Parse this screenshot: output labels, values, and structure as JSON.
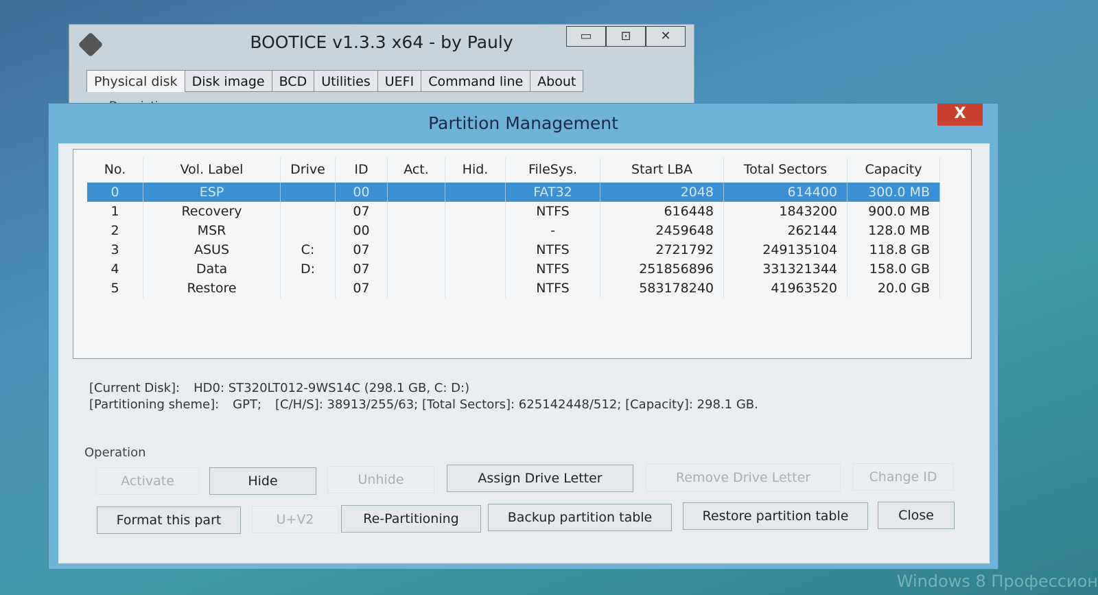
{
  "main_window": {
    "title": "BOOTICE v1.3.3 x64 - by Pauly",
    "controls": [
      "▭",
      "⊡",
      "✕"
    ],
    "tabs": [
      {
        "label": "Physical disk",
        "active": true
      },
      {
        "label": "Disk image"
      },
      {
        "label": "BCD"
      },
      {
        "label": "Utilities"
      },
      {
        "label": "UEFI"
      },
      {
        "label": "Command line"
      },
      {
        "label": "About"
      }
    ],
    "description_label": "Description"
  },
  "dialog": {
    "title": "Partition Management",
    "close": "X",
    "columns": [
      "No.",
      "Vol. Label",
      "Drive",
      "ID",
      "Act.",
      "Hid.",
      "FileSys.",
      "Start LBA",
      "Total Sectors",
      "Capacity"
    ],
    "rows": [
      [
        "0",
        "ESP",
        "",
        "00",
        "",
        "",
        "FAT32",
        "2048",
        "614400",
        "300.0 MB"
      ],
      [
        "1",
        "Recovery",
        "",
        "07",
        "",
        "",
        "NTFS",
        "616448",
        "1843200",
        "900.0 MB"
      ],
      [
        "2",
        "MSR",
        "",
        "00",
        "",
        "",
        "-",
        "2459648",
        "262144",
        "128.0 MB"
      ],
      [
        "3",
        "ASUS",
        "C:",
        "07",
        "",
        "",
        "NTFS",
        "2721792",
        "249135104",
        "118.8 GB"
      ],
      [
        "4",
        "Data",
        "D:",
        "07",
        "",
        "",
        "NTFS",
        "251856896",
        "331321344",
        "158.0 GB"
      ],
      [
        "5",
        "Restore",
        "",
        "07",
        "",
        "",
        "NTFS",
        "583178240",
        "41963520",
        "20.0 GB"
      ]
    ],
    "selected_row": 0,
    "info": {
      "current_disk_label": "[Current Disk]:",
      "current_disk": "HD0: ST320LT012-9WS14C (298.1 GB, C: D:)",
      "scheme_label": "[Partitioning sheme]:",
      "scheme": "GPT;",
      "details": "[C/H/S]: 38913/255/63; [Total Sectors]: 625142448/512; [Capacity]: 298.1 GB."
    },
    "operation_label": "Operation",
    "buttons": {
      "activate": "Activate",
      "hide": "Hide",
      "unhide": "Unhide",
      "assign": "Assign Drive Letter",
      "remove": "Remove Drive Letter",
      "change_id": "Change ID",
      "format": "Format this part",
      "uv2": "U+V2",
      "repartition": "Re-Partitioning",
      "backup": "Backup partition table",
      "restore": "Restore partition table",
      "close": "Close"
    }
  },
  "desktop": {
    "watermark": "Windows 8 Профессион"
  },
  "colors": {
    "selection": "#3d8fd4",
    "dialog_frame": "#6fb3d9",
    "close_button": "#c8402f"
  }
}
